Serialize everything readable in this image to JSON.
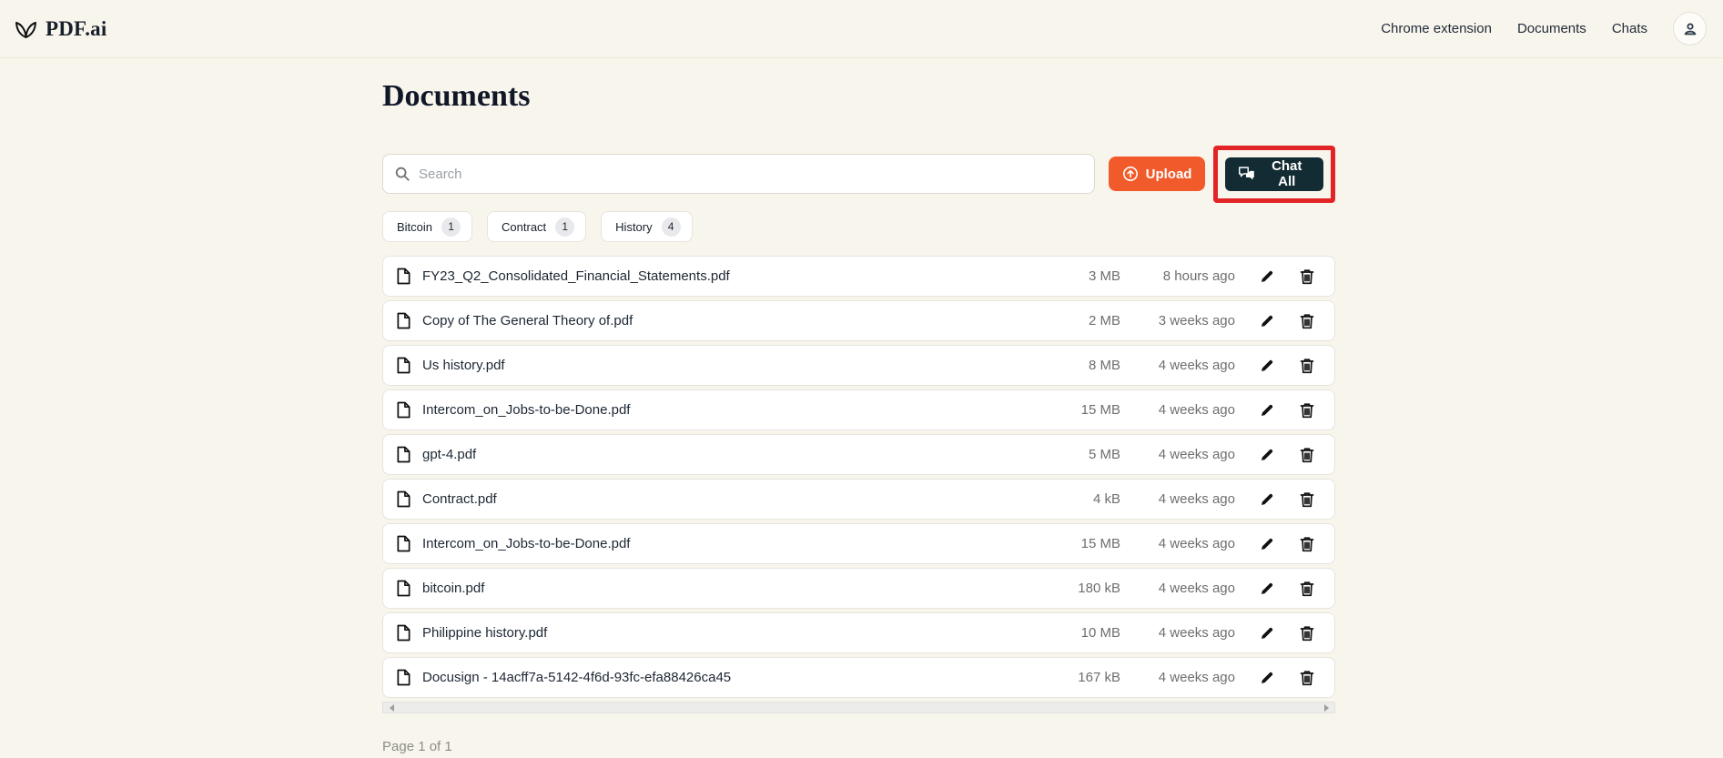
{
  "brand": {
    "name": "PDF.ai"
  },
  "nav": {
    "items": [
      {
        "label": "Chrome extension"
      },
      {
        "label": "Documents"
      },
      {
        "label": "Chats"
      }
    ]
  },
  "page": {
    "title": "Documents",
    "pagination": "Page 1 of 1"
  },
  "search": {
    "placeholder": "Search"
  },
  "actions": {
    "upload_label": "Upload",
    "chat_all_label": "Chat All"
  },
  "tags": [
    {
      "label": "Bitcoin",
      "count": "1"
    },
    {
      "label": "Contract",
      "count": "1"
    },
    {
      "label": "History",
      "count": "4"
    }
  ],
  "documents": [
    {
      "name": "FY23_Q2_Consolidated_Financial_Statements.pdf",
      "size": "3 MB",
      "modified": "8 hours ago"
    },
    {
      "name": "Copy of The General Theory of.pdf",
      "size": "2 MB",
      "modified": "3 weeks ago"
    },
    {
      "name": "Us history.pdf",
      "size": "8 MB",
      "modified": "4 weeks ago"
    },
    {
      "name": "Intercom_on_Jobs-to-be-Done.pdf",
      "size": "15 MB",
      "modified": "4 weeks ago"
    },
    {
      "name": "gpt-4.pdf",
      "size": "5 MB",
      "modified": "4 weeks ago"
    },
    {
      "name": "Contract.pdf",
      "size": "4 kB",
      "modified": "4 weeks ago"
    },
    {
      "name": "Intercom_on_Jobs-to-be-Done.pdf",
      "size": "15 MB",
      "modified": "4 weeks ago"
    },
    {
      "name": "bitcoin.pdf",
      "size": "180 kB",
      "modified": "4 weeks ago"
    },
    {
      "name": "Philippine history.pdf",
      "size": "10 MB",
      "modified": "4 weeks ago"
    },
    {
      "name": "Docusign - 14acff7a-5142-4f6d-93fc-efa88426ca45",
      "size": "167 kB",
      "modified": "4 weeks ago"
    }
  ],
  "colors": {
    "background": "#f8f5ed",
    "accent_orange": "#f15b2b",
    "dark_button": "#132b33",
    "highlight_red": "#e32427"
  }
}
